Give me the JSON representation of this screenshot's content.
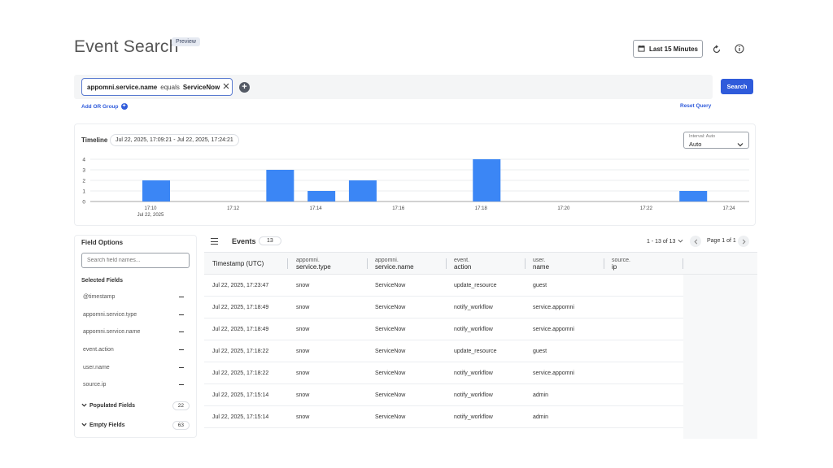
{
  "header": {
    "title": "Event Search",
    "badge": "Preview",
    "time_range": "Last 15 Minutes"
  },
  "query": {
    "field": "appomni.service.name",
    "operator": "equals",
    "value": "ServiceNow",
    "search_label": "Search",
    "add_or_group": "Add OR Group",
    "reset_query": "Reset Query"
  },
  "timeline": {
    "label": "Timeline",
    "range": "Jul 22, 2025, 17:09:21 - Jul 22, 2025, 17:24:21",
    "interval_label": "Interval: Auto",
    "interval_value": "Auto"
  },
  "chart_data": {
    "type": "bar",
    "x_ticks": [
      "17:10",
      "17:12",
      "17:14",
      "17:16",
      "17:18",
      "17:20",
      "17:22",
      "17:24"
    ],
    "x_tick_sublabel": "Jul 22, 2025",
    "y_ticks": [
      0,
      1,
      2,
      3,
      4
    ],
    "ylim": [
      0,
      4
    ],
    "grid": true,
    "bar_color": "#3b86f5",
    "bars": [
      {
        "minute": 10,
        "value": 2
      },
      {
        "minute": 13,
        "value": 3
      },
      {
        "minute": 14,
        "value": 1
      },
      {
        "minute": 15,
        "value": 2
      },
      {
        "minute": 18,
        "value": 4
      },
      {
        "minute": 23,
        "value": 1
      }
    ]
  },
  "field_options": {
    "title": "Field Options",
    "search_placeholder": "Search field names...",
    "selected_title": "Selected Fields",
    "selected": [
      "@timestamp",
      "appomni.service.type",
      "appomni.service.name",
      "event.action",
      "user.name",
      "source.ip"
    ],
    "populated_label": "Populated Fields",
    "populated_count": "22",
    "empty_label": "Empty Fields",
    "empty_count": "63"
  },
  "events": {
    "title": "Events",
    "count": "13",
    "pager_range": "1 - 13 of 13",
    "pager_label": "Page 1 of 1",
    "columns": [
      {
        "l1": "",
        "l2": "Timestamp (UTC)"
      },
      {
        "l1": "appomni.",
        "l2": "service.type"
      },
      {
        "l1": "appomni.",
        "l2": "service.name"
      },
      {
        "l1": "event.",
        "l2": "action"
      },
      {
        "l1": "user.",
        "l2": "name"
      },
      {
        "l1": "source.",
        "l2": "ip"
      }
    ],
    "rows": [
      [
        "Jul 22, 2025, 17:23:47",
        "snow",
        "ServiceNow",
        "update_resource",
        "guest",
        ""
      ],
      [
        "Jul 22, 2025, 17:18:49",
        "snow",
        "ServiceNow",
        "notify_workflow",
        "service.appomni",
        ""
      ],
      [
        "Jul 22, 2025, 17:18:49",
        "snow",
        "ServiceNow",
        "notify_workflow",
        "service.appomni",
        ""
      ],
      [
        "Jul 22, 2025, 17:18:22",
        "snow",
        "ServiceNow",
        "update_resource",
        "guest",
        ""
      ],
      [
        "Jul 22, 2025, 17:18:22",
        "snow",
        "ServiceNow",
        "notify_workflow",
        "service.appomni",
        ""
      ],
      [
        "Jul 22, 2025, 17:15:14",
        "snow",
        "ServiceNow",
        "notify_workflow",
        "admin",
        ""
      ],
      [
        "Jul 22, 2025, 17:15:14",
        "snow",
        "ServiceNow",
        "notify_workflow",
        "admin",
        ""
      ]
    ]
  }
}
